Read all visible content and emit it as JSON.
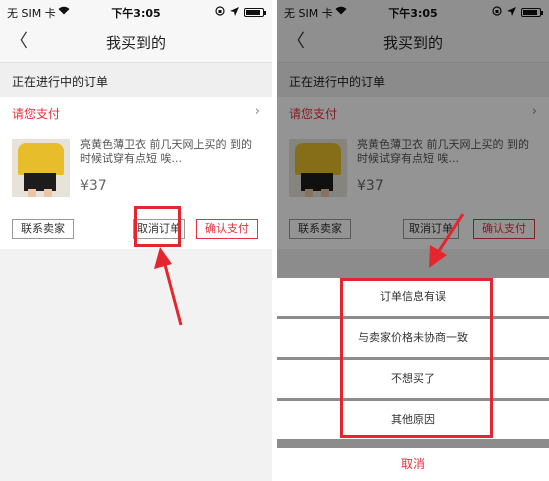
{
  "status_bar": {
    "carrier": "无 SIM 卡",
    "time": "下午3:05"
  },
  "nav": {
    "title": "我买到的"
  },
  "order": {
    "section_label": "正在进行中的订单",
    "pay_label": "请您支付",
    "item_description": "亮黄色薄卫衣 前几天网上买的 到的时候试穿有点短 唉...",
    "price": "¥37",
    "buttons": {
      "contact_seller": "联系卖家",
      "cancel_order": "取消订单",
      "confirm_pay": "确认支付"
    }
  },
  "cancel_sheet": {
    "options": [
      "订单信息有误",
      "与卖家价格未协商一致",
      "不想买了",
      "其他原因"
    ],
    "cancel": "取消"
  },
  "colors": {
    "accent_red": "#e5323d",
    "annotation_red": "#e5262f"
  }
}
